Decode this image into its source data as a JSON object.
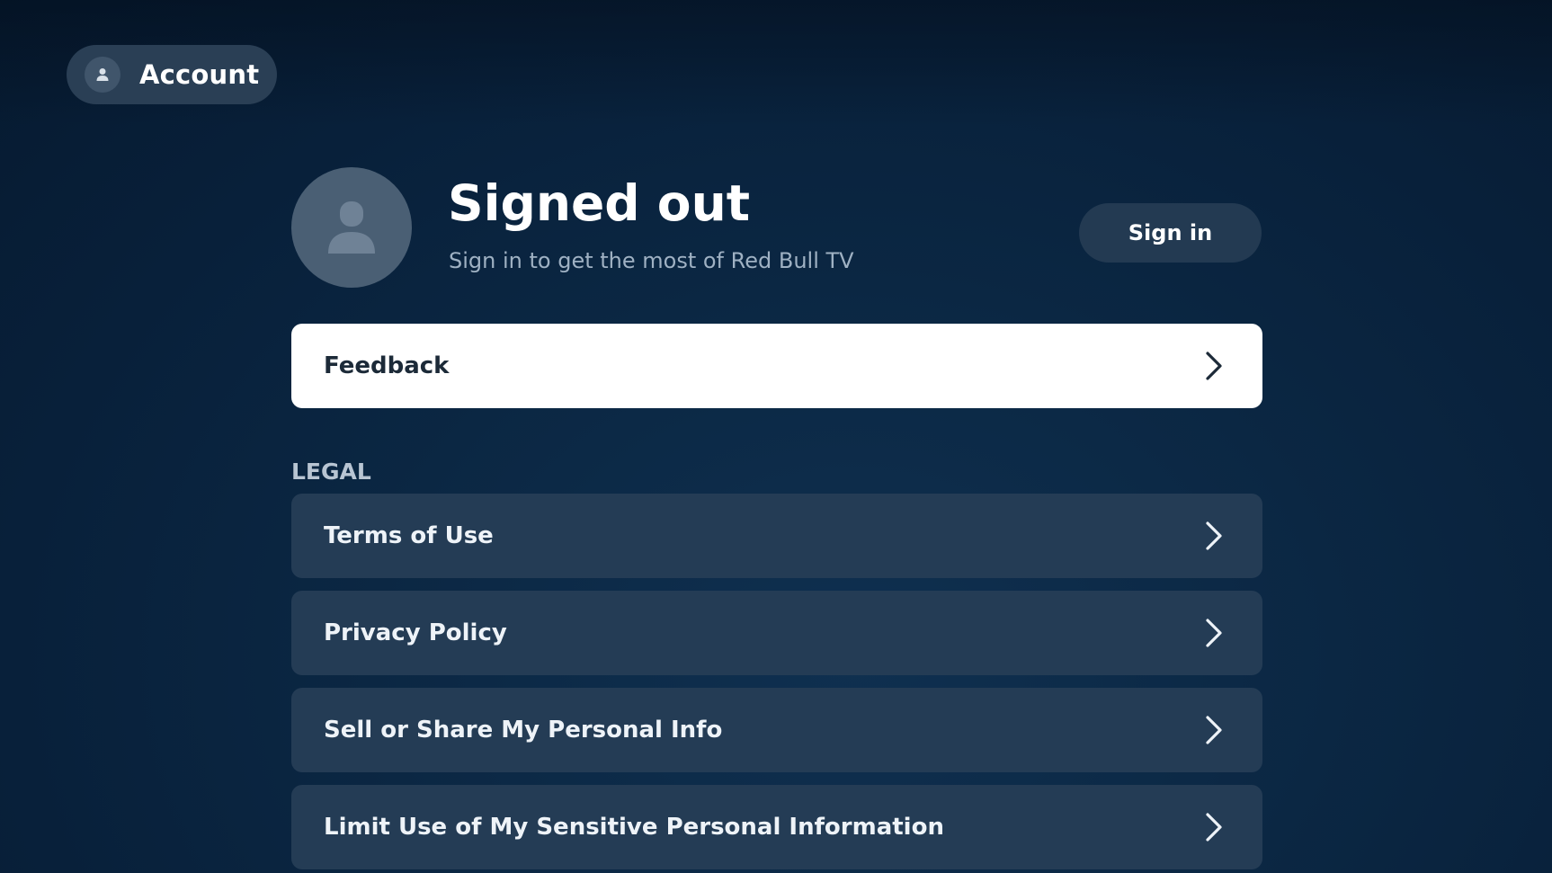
{
  "header": {
    "account_label": "Account",
    "account_icon": "user-icon"
  },
  "profile": {
    "title": "Signed out",
    "subtitle": "Sign in to get the most of Red Bull TV",
    "avatar_icon": "user-silhouette-icon",
    "sign_in_label": "Sign in"
  },
  "feedback": {
    "label": "Feedback",
    "focused": true
  },
  "legal": {
    "heading": "LEGAL",
    "items": [
      {
        "label": "Terms of Use"
      },
      {
        "label": "Privacy Policy"
      },
      {
        "label": "Sell or Share My Personal Info"
      },
      {
        "label": "Limit Use of My Sensitive Personal Information"
      }
    ]
  },
  "colors": {
    "background": "#0b2743",
    "row_background": "#243c55",
    "focused_row_background": "#ffffff",
    "focused_row_text": "#1c2a38",
    "subtitle_text": "#9fb1c3"
  }
}
